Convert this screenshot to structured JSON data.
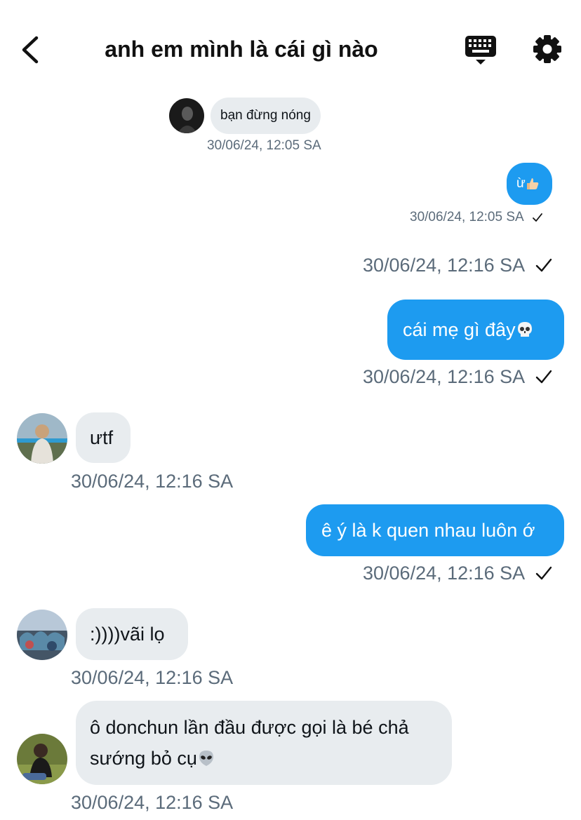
{
  "header": {
    "title": "anh em mình là cái gì nào"
  },
  "messages": [
    {
      "side": "in",
      "text": "bạn đừng nóng",
      "time": "30/06/24, 12:05 SA"
    },
    {
      "side": "out",
      "text": "ừ",
      "emoji": "thumbs-up",
      "time": "30/06/24, 12:05 SA",
      "status": "sent-check"
    },
    {
      "side": "out",
      "time": "30/06/24, 12:16 SA",
      "status": "sent-check"
    },
    {
      "side": "out",
      "text": "cái mẹ gì đây",
      "emoji": "skull",
      "time": "30/06/24, 12:16 SA",
      "status": "sent-check"
    },
    {
      "side": "in",
      "text": "ưtf",
      "time": "30/06/24, 12:16 SA"
    },
    {
      "side": "out",
      "text": "ê ý là k quen nhau luôn ớ",
      "time": "30/06/24, 12:16 SA",
      "status": "sent-check"
    },
    {
      "side": "in",
      "text": ":))))vãi lọ",
      "time": "30/06/24, 12:16 SA"
    },
    {
      "side": "in",
      "text_line1": "ô donchun lần đầu được gọi là bé chả",
      "text_line2": "sướng bỏ cụ",
      "emoji": "alien",
      "time": "30/06/24, 12:16 SA"
    }
  ],
  "colors": {
    "outgoing": "#1d9bf0",
    "incoming": "#e8ecef",
    "timestamp": "#5b6b7a"
  },
  "icons": [
    "back-arrow-icon",
    "keyboard-icon",
    "gear-icon",
    "check-icon",
    "skull-emoji",
    "thumbs-up-emoji",
    "alien-emoji"
  ]
}
